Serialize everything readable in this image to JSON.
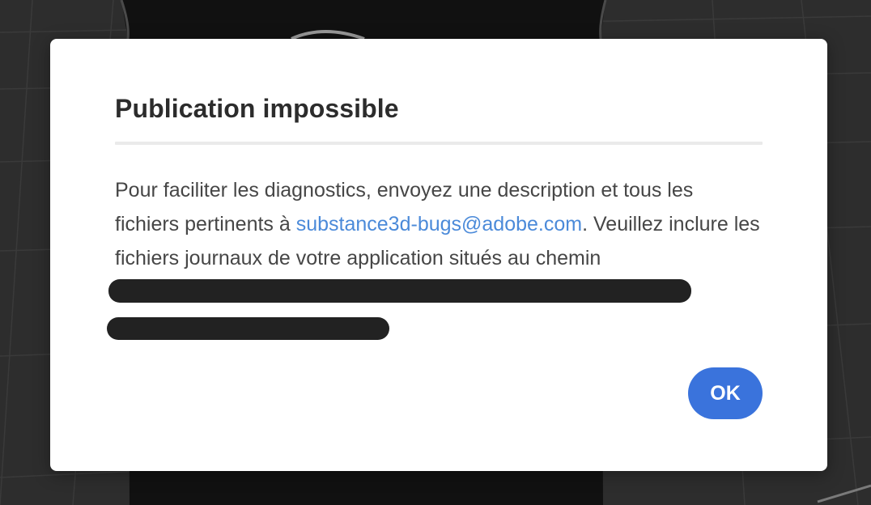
{
  "dialog": {
    "title": "Publication impossible",
    "body_part1": "Pour faciliter les diagnostics, envoyez une description et tous les fichiers pertinents à ",
    "email_link": "substance3d-bugs@adobe.com",
    "body_part2": ". Veuillez inclure les fichiers journaux de votre application situés au chemin",
    "ok_label": "OK"
  },
  "colors": {
    "accent": "#3a73dc",
    "link": "#4b8ad9",
    "background": "#2d2d2d",
    "dialog_bg": "#ffffff",
    "redaction": "#222222"
  }
}
